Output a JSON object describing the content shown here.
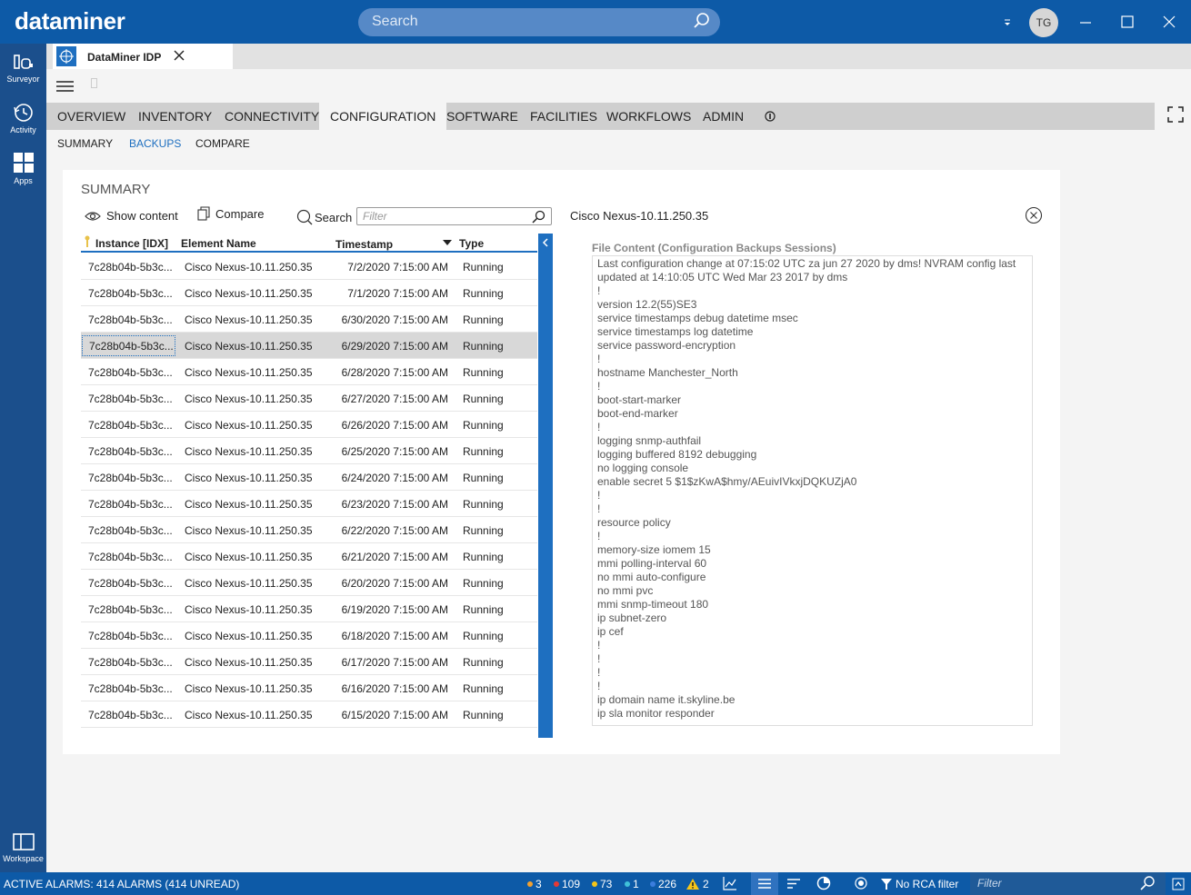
{
  "app": {
    "logo": "dataminer",
    "search_placeholder": "Search",
    "user_initials": "TG"
  },
  "nav": {
    "surveyor": "Surveyor",
    "activity": "Activity",
    "apps": "Apps",
    "workspace": "Workspace"
  },
  "doc_tab": {
    "label": "DataMiner IDP"
  },
  "main_tabs": [
    "OVERVIEW",
    "INVENTORY",
    "CONNECTIVITY",
    "CONFIGURATION",
    "SOFTWARE",
    "FACILITIES",
    "WORKFLOWS",
    "ADMIN"
  ],
  "sub_tabs": [
    "SUMMARY",
    "BACKUPS",
    "COMPARE"
  ],
  "card": {
    "title": "SUMMARY",
    "show_content": "Show content",
    "compare": "Compare",
    "search": "Search",
    "filter_placeholder": "Filter"
  },
  "grid": {
    "headers": [
      "Instance [IDX]",
      "Element Name",
      "Timestamp",
      "Type"
    ],
    "rows": [
      [
        "7c28b04b-5b3c...",
        "Cisco Nexus-10.11.250.35",
        "7/2/2020 7:15:00 AM",
        "Running"
      ],
      [
        "7c28b04b-5b3c...",
        "Cisco Nexus-10.11.250.35",
        "7/1/2020 7:15:00 AM",
        "Running"
      ],
      [
        "7c28b04b-5b3c...",
        "Cisco Nexus-10.11.250.35",
        "6/30/2020 7:15:00 AM",
        "Running"
      ],
      [
        "7c28b04b-5b3c...",
        "Cisco Nexus-10.11.250.35",
        "6/29/2020 7:15:00 AM",
        "Running"
      ],
      [
        "7c28b04b-5b3c...",
        "Cisco Nexus-10.11.250.35",
        "6/28/2020 7:15:00 AM",
        "Running"
      ],
      [
        "7c28b04b-5b3c...",
        "Cisco Nexus-10.11.250.35",
        "6/27/2020 7:15:00 AM",
        "Running"
      ],
      [
        "7c28b04b-5b3c...",
        "Cisco Nexus-10.11.250.35",
        "6/26/2020 7:15:00 AM",
        "Running"
      ],
      [
        "7c28b04b-5b3c...",
        "Cisco Nexus-10.11.250.35",
        "6/25/2020 7:15:00 AM",
        "Running"
      ],
      [
        "7c28b04b-5b3c...",
        "Cisco Nexus-10.11.250.35",
        "6/24/2020 7:15:00 AM",
        "Running"
      ],
      [
        "7c28b04b-5b3c...",
        "Cisco Nexus-10.11.250.35",
        "6/23/2020 7:15:00 AM",
        "Running"
      ],
      [
        "7c28b04b-5b3c...",
        "Cisco Nexus-10.11.250.35",
        "6/22/2020 7:15:00 AM",
        "Running"
      ],
      [
        "7c28b04b-5b3c...",
        "Cisco Nexus-10.11.250.35",
        "6/21/2020 7:15:00 AM",
        "Running"
      ],
      [
        "7c28b04b-5b3c...",
        "Cisco Nexus-10.11.250.35",
        "6/20/2020 7:15:00 AM",
        "Running"
      ],
      [
        "7c28b04b-5b3c...",
        "Cisco Nexus-10.11.250.35",
        "6/19/2020 7:15:00 AM",
        "Running"
      ],
      [
        "7c28b04b-5b3c...",
        "Cisco Nexus-10.11.250.35",
        "6/18/2020 7:15:00 AM",
        "Running"
      ],
      [
        "7c28b04b-5b3c...",
        "Cisco Nexus-10.11.250.35",
        "6/17/2020 7:15:00 AM",
        "Running"
      ],
      [
        "7c28b04b-5b3c...",
        "Cisco Nexus-10.11.250.35",
        "6/16/2020 7:15:00 AM",
        "Running"
      ],
      [
        "7c28b04b-5b3c...",
        "Cisco Nexus-10.11.250.35",
        "6/15/2020 7:15:00 AM",
        "Running"
      ]
    ],
    "selected_index": 3
  },
  "detail": {
    "device": "Cisco Nexus-10.11.250.35",
    "file_content_label": "File Content (Configuration Backups Sessions)",
    "lines": [
      "Last configuration change at 07:15:02 UTC za jun 27 2020 by dms! NVRAM config last",
      "updated at 14:10:05 UTC Wed Mar 23 2017 by dms",
      "!",
      "version 12.2(55)SE3",
      "service timestamps debug datetime msec",
      "service timestamps log datetime",
      "service password-encryption",
      "!",
      "hostname Manchester_North",
      "!",
      "boot-start-marker",
      "boot-end-marker",
      "!",
      "logging snmp-authfail",
      "logging buffered 8192 debugging",
      "no logging console",
      "enable secret 5 $1$zKwA$hmy/AEuivIVkxjDQKUZjA0",
      "!",
      "!",
      "resource policy",
      "!",
      "memory-size iomem 15",
      "mmi polling-interval 60",
      "no mmi auto-configure",
      "no mmi pvc",
      "mmi snmp-timeout 180",
      "ip subnet-zero",
      "ip cef",
      "!",
      "!",
      "!",
      "!",
      "ip domain name it.skyline.be",
      "ip sla monitor responder"
    ]
  },
  "statusbar": {
    "alarms": "ACTIVE ALARMS: 414 ALARMS (414 UNREAD)",
    "counts": [
      {
        "value": "3",
        "color": "#f0a030"
      },
      {
        "value": "109",
        "color": "#e53935"
      },
      {
        "value": "73",
        "color": "#f5c518"
      },
      {
        "value": "1",
        "color": "#3fc1d9"
      },
      {
        "value": "226",
        "color": "#3b7ddd"
      }
    ],
    "warnings": "2",
    "rca": "No RCA filter",
    "filter_placeholder": "Filter"
  }
}
